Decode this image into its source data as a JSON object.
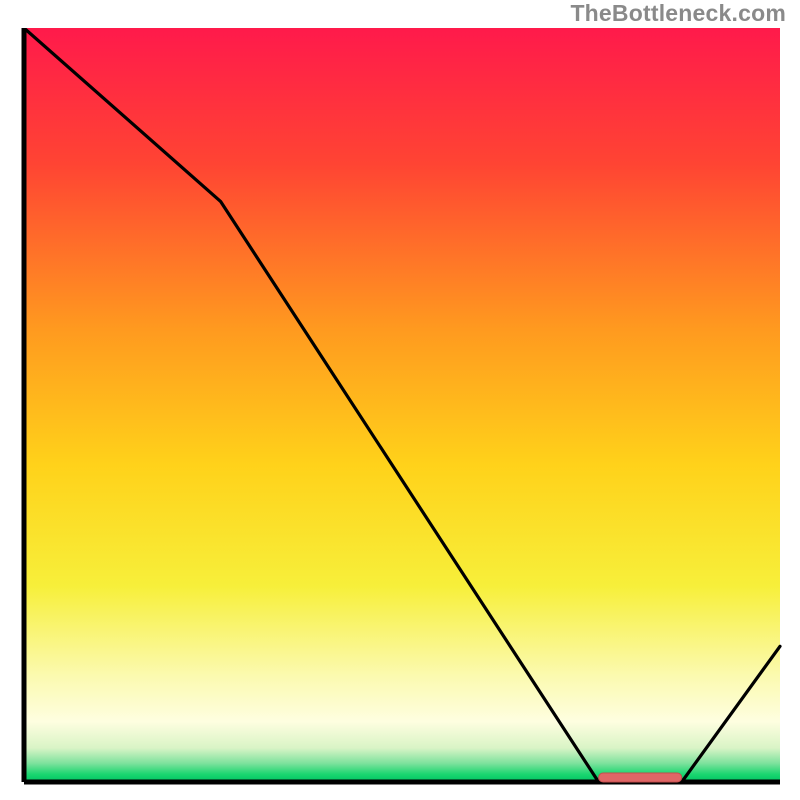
{
  "attribution": "TheBottleneck.com",
  "chart_data": {
    "type": "line",
    "title": "",
    "xlabel": "",
    "ylabel": "",
    "xlim": [
      0,
      100
    ],
    "ylim": [
      0,
      100
    ],
    "x": [
      0,
      26,
      76,
      87,
      100
    ],
    "values": [
      100,
      77,
      0,
      0,
      18
    ],
    "marker": {
      "x_range": [
        76,
        87
      ],
      "y": 0
    },
    "background": {
      "type": "vertical_gradient",
      "stops": [
        {
          "offset": 0.0,
          "color": "#ff1a4b"
        },
        {
          "offset": 0.18,
          "color": "#ff4433"
        },
        {
          "offset": 0.4,
          "color": "#ff9a1f"
        },
        {
          "offset": 0.58,
          "color": "#ffd21a"
        },
        {
          "offset": 0.74,
          "color": "#f7ef3a"
        },
        {
          "offset": 0.86,
          "color": "#fbfab0"
        },
        {
          "offset": 0.92,
          "color": "#fefee0"
        },
        {
          "offset": 0.955,
          "color": "#d9f4c6"
        },
        {
          "offset": 0.975,
          "color": "#7ee29d"
        },
        {
          "offset": 0.99,
          "color": "#19d66f"
        },
        {
          "offset": 1.0,
          "color": "#00c463"
        }
      ]
    },
    "colors": {
      "axis": "#000000",
      "series_line": "#000000",
      "marker_fill": "#e06666",
      "marker_stroke": "#c44d4d"
    }
  }
}
